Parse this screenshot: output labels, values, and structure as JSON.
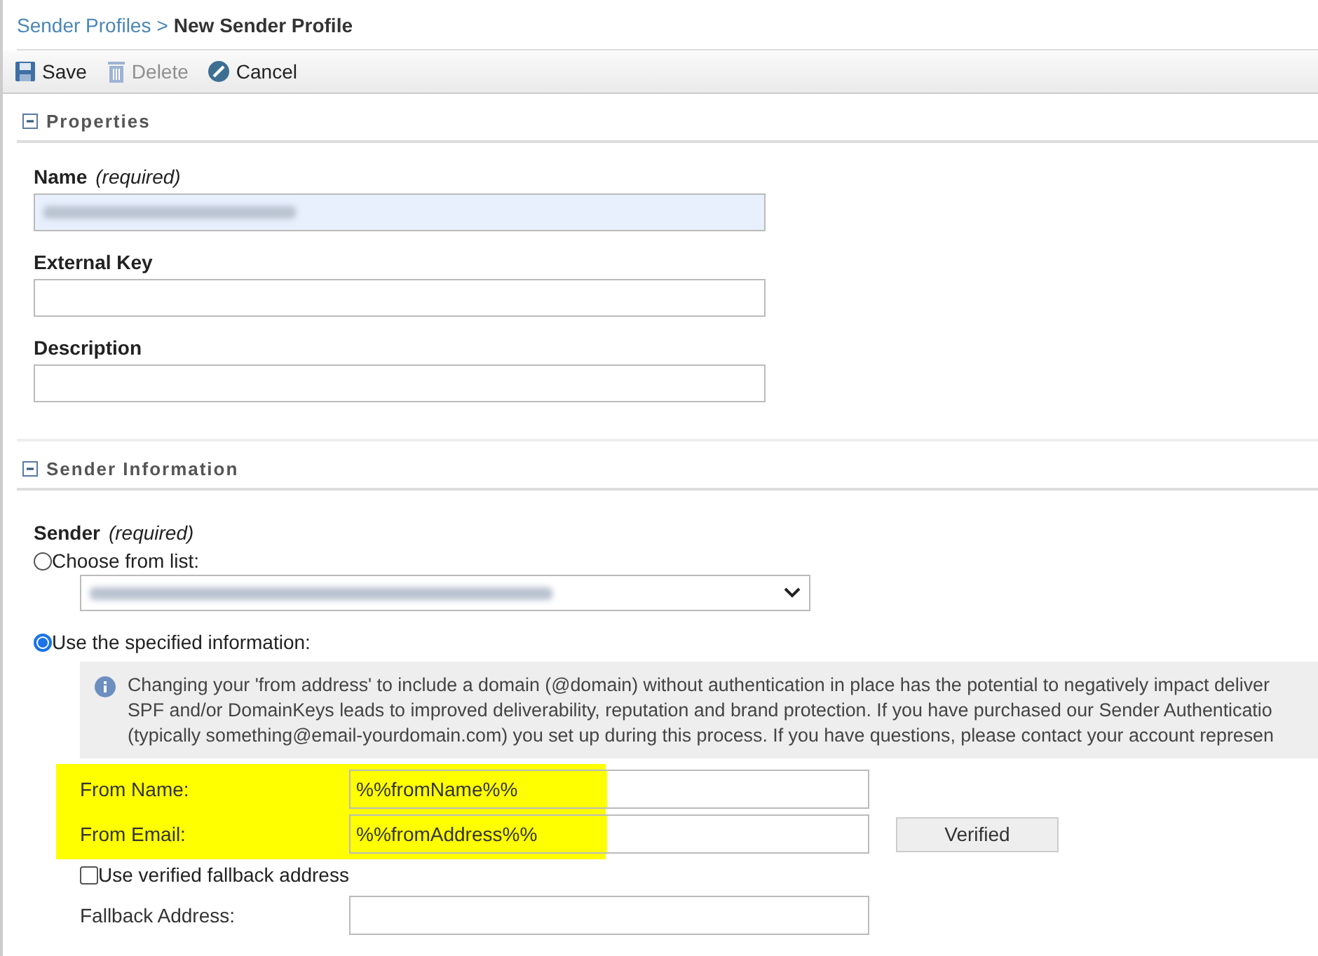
{
  "breadcrumb": {
    "parent": "Sender Profiles",
    "separator": ">",
    "current": "New Sender Profile"
  },
  "toolbar": [
    {
      "kind": "save",
      "label": "Save",
      "disabled": false
    },
    {
      "kind": "delete",
      "label": "Delete",
      "disabled": true
    },
    {
      "kind": "cancel",
      "label": "Cancel",
      "disabled": false
    }
  ],
  "properties": {
    "title": "Properties",
    "expanded": true,
    "fields": [
      {
        "label": "Name",
        "note": "(required)",
        "redacted": true
      },
      {
        "label": "External Key",
        "redacted": false
      },
      {
        "label": "Description",
        "redacted": false
      }
    ]
  },
  "sender_information": {
    "title": "Sender Information",
    "expanded": true,
    "label": "Sender",
    "note": "(required)",
    "options": [
      {
        "label": "Choose from list:",
        "selected": false,
        "kind": "list"
      },
      {
        "label": "Use the specified information:",
        "selected": true,
        "kind": "specified"
      }
    ],
    "info_lines": [
      "Changing your 'from address' to include a domain (@domain) without authentication in place has the potential to negatively impact deliver",
      "SPF and/or DomainKeys leads to improved deliverability, reputation and brand protection. If you have purchased our Sender Authenticatio",
      "(typically something@email-yourdomain.com) you set up during this process. If you have questions, please contact your account represen"
    ],
    "from_name": {
      "label": "From Name:",
      "value": "%%fromName%%"
    },
    "from_email": {
      "label": "From Email:",
      "value": "%%fromAddress%%",
      "button": "Verified"
    },
    "fallback_checkbox": {
      "label": "Use verified fallback address",
      "checked": false
    },
    "fallback_address": {
      "label": "Fallback Address:"
    }
  }
}
